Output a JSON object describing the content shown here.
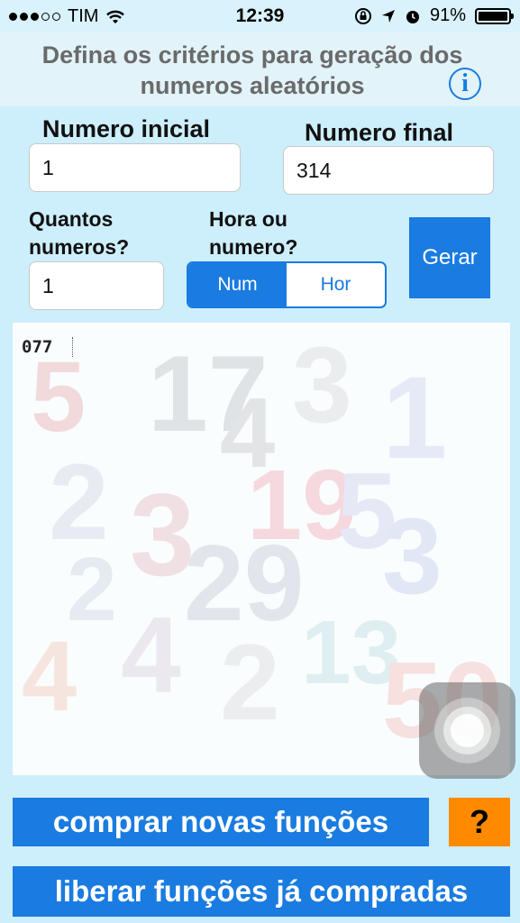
{
  "status_bar": {
    "carrier": "TIM",
    "signal_bars": 3,
    "time": "12:39",
    "battery": "91%"
  },
  "header": {
    "title": "Defina os critérios para geração dos numeros aleatórios",
    "info_icon_glyph": "i"
  },
  "form": {
    "start_label": "Numero inicial",
    "start_value": "1",
    "end_label": "Numero final",
    "end_value": "314",
    "count_label": "Quantos numeros?",
    "count_value": "1",
    "mode_label": "Hora ou numero?",
    "mode_options": [
      "Num",
      "Hor"
    ],
    "mode_selected": "Num",
    "generate_label": "Gerar"
  },
  "output": {
    "text": "077"
  },
  "footer": {
    "buy_label": "comprar novas funções",
    "help_label": "?",
    "restore_label": "liberar funções já compradas"
  },
  "colors": {
    "accent_blue": "#1a7be0",
    "help_orange": "#ff8a00",
    "background": "#cdeefb"
  },
  "icons": [
    "signal-dots-icon",
    "wifi-icon",
    "lock-rotation-icon",
    "location-arrow-icon",
    "alarm-icon",
    "battery-icon",
    "info-icon",
    "assistive-touch-icon"
  ]
}
